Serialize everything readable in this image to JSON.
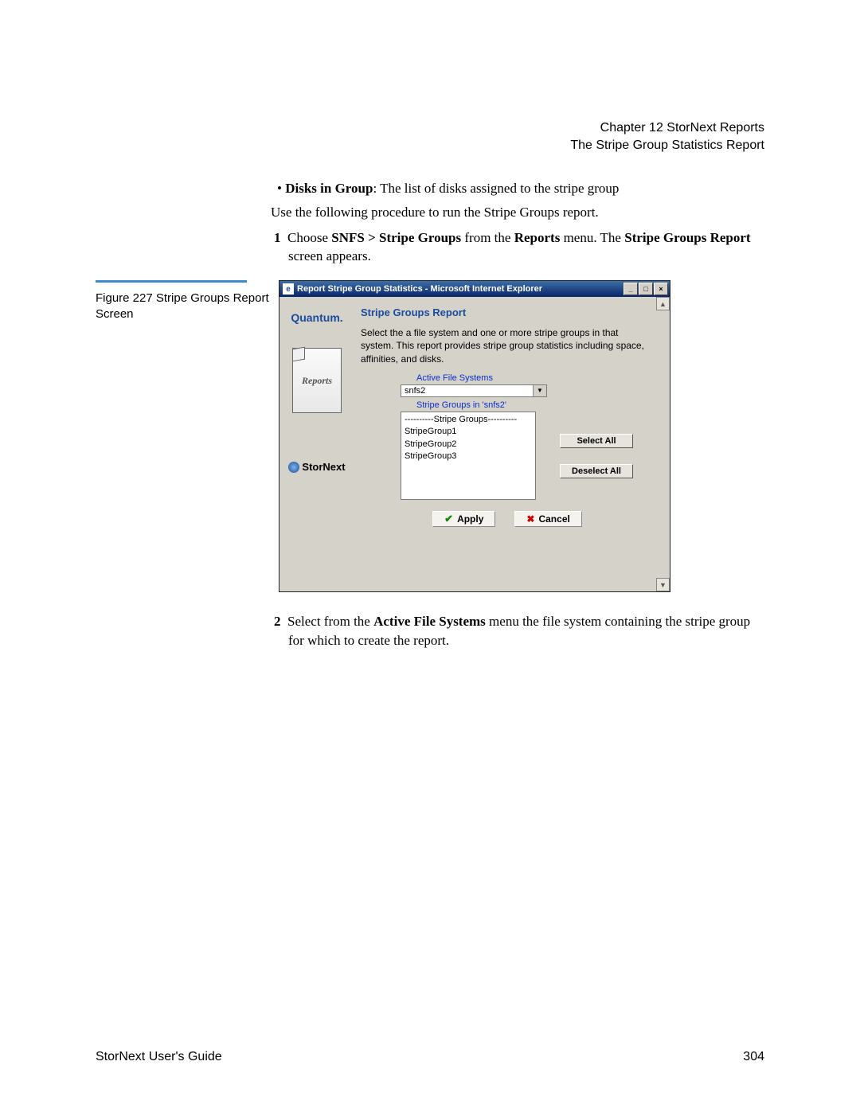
{
  "header": {
    "chapter": "Chapter 12  StorNext Reports",
    "section": "The Stripe Group Statistics Report"
  },
  "bullet": {
    "label": "Disks in Group",
    "desc": ": The list of disks assigned to the stripe group"
  },
  "intro_para": "Use the following procedure to run the Stripe Groups report.",
  "step1": {
    "num": "1",
    "pre": "Choose ",
    "bold1": "SNFS > Stripe Groups",
    "mid": " from the ",
    "bold2": "Reports",
    "mid2": " menu. The ",
    "bold3": "Stripe Groups Report",
    "post": " screen appears."
  },
  "figure_caption": "Figure 227  Stripe Groups Report Screen",
  "ie": {
    "title": "Report Stripe Group Statistics - Microsoft Internet Explorer",
    "brand": "Quantum.",
    "reports_box": "Reports",
    "storNext": "StorNext",
    "panel_title": "Stripe Groups Report",
    "panel_desc": "Select the a file system and one or more stripe groups in that system. This report provides stripe group statistics including space, affinities, and disks.",
    "afs_label": "Active File Systems",
    "afs_value": "snfs2",
    "sg_label": "Stripe Groups in 'snfs2'",
    "listbox_items": [
      "----------Stripe Groups----------",
      "StripeGroup1",
      "StripeGroup2",
      "StripeGroup3"
    ],
    "select_all": "Select All",
    "deselect_all": "Deselect All",
    "apply": "Apply",
    "cancel": "Cancel"
  },
  "step2": {
    "num": "2",
    "pre": "Select from the ",
    "bold1": "Active File Systems",
    "post": " menu the file system containing the stripe group for which to create the report."
  },
  "footer": {
    "left": "StorNext User's Guide",
    "right": "304"
  }
}
